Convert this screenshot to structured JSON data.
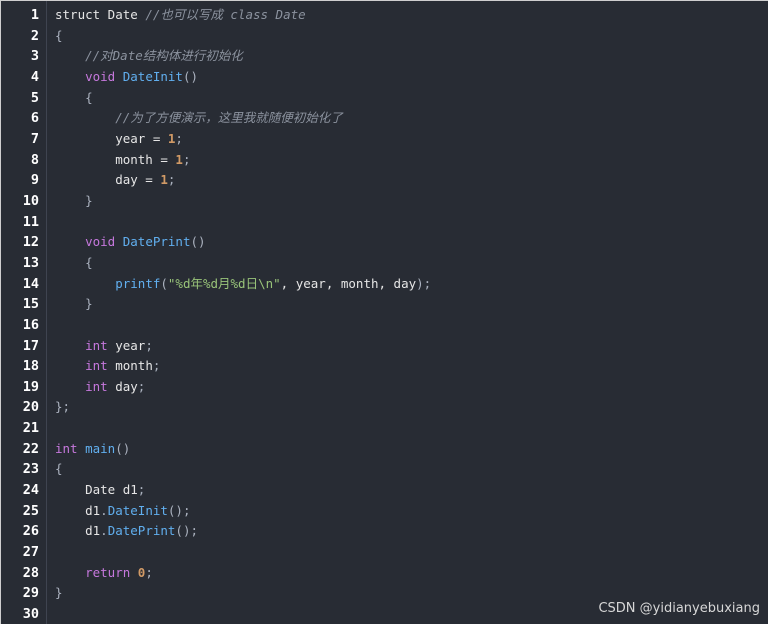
{
  "watermark": "CSDN @yidianyebuxiang",
  "colors": {
    "background": "#282c34",
    "line_number": "#ffffff",
    "keyword": "#c678dd",
    "function": "#61afef",
    "number": "#d19a66",
    "string": "#98c379",
    "comment": "#8b929e"
  },
  "lines": [
    {
      "num": "1",
      "tokens": [
        [
          "ident",
          "struct Date "
        ],
        [
          "cmt",
          "//也可以写成 class Date"
        ]
      ]
    },
    {
      "num": "2",
      "tokens": [
        [
          "punct",
          "{"
        ]
      ]
    },
    {
      "num": "3",
      "tokens": [
        [
          "punct",
          "    "
        ],
        [
          "cmt",
          "//对Date结构体进行初始化"
        ]
      ]
    },
    {
      "num": "4",
      "tokens": [
        [
          "punct",
          "    "
        ],
        [
          "kw",
          "void"
        ],
        [
          "ident",
          " "
        ],
        [
          "fn",
          "DateInit"
        ],
        [
          "punct",
          "()"
        ]
      ]
    },
    {
      "num": "5",
      "tokens": [
        [
          "punct",
          "    {"
        ]
      ]
    },
    {
      "num": "6",
      "tokens": [
        [
          "punct",
          "        "
        ],
        [
          "cmt",
          "//为了方便演示，这里我就随便初始化了"
        ]
      ]
    },
    {
      "num": "7",
      "tokens": [
        [
          "ident",
          "        year = "
        ],
        [
          "num",
          "1"
        ],
        [
          "punct",
          ";"
        ]
      ]
    },
    {
      "num": "8",
      "tokens": [
        [
          "ident",
          "        month = "
        ],
        [
          "num",
          "1"
        ],
        [
          "punct",
          ";"
        ]
      ]
    },
    {
      "num": "9",
      "tokens": [
        [
          "ident",
          "        day = "
        ],
        [
          "num",
          "1"
        ],
        [
          "punct",
          ";"
        ]
      ]
    },
    {
      "num": "10",
      "tokens": [
        [
          "punct",
          "    }"
        ]
      ]
    },
    {
      "num": "11",
      "tokens": []
    },
    {
      "num": "12",
      "tokens": [
        [
          "punct",
          "    "
        ],
        [
          "kw",
          "void"
        ],
        [
          "ident",
          " "
        ],
        [
          "fn",
          "DatePrint"
        ],
        [
          "punct",
          "()"
        ]
      ]
    },
    {
      "num": "13",
      "tokens": [
        [
          "punct",
          "    {"
        ]
      ]
    },
    {
      "num": "14",
      "tokens": [
        [
          "punct",
          "        "
        ],
        [
          "fn",
          "printf"
        ],
        [
          "punct",
          "("
        ],
        [
          "str",
          "\"%d年%d月%d日\\n\""
        ],
        [
          "ident",
          ", year, month, day"
        ],
        [
          "punct",
          ");"
        ]
      ]
    },
    {
      "num": "15",
      "tokens": [
        [
          "punct",
          "    }"
        ]
      ]
    },
    {
      "num": "16",
      "tokens": []
    },
    {
      "num": "17",
      "tokens": [
        [
          "punct",
          "    "
        ],
        [
          "kw",
          "int"
        ],
        [
          "ident",
          " year"
        ],
        [
          "punct",
          ";"
        ]
      ]
    },
    {
      "num": "18",
      "tokens": [
        [
          "punct",
          "    "
        ],
        [
          "kw",
          "int"
        ],
        [
          "ident",
          " month"
        ],
        [
          "punct",
          ";"
        ]
      ]
    },
    {
      "num": "19",
      "tokens": [
        [
          "punct",
          "    "
        ],
        [
          "kw",
          "int"
        ],
        [
          "ident",
          " day"
        ],
        [
          "punct",
          ";"
        ]
      ]
    },
    {
      "num": "20",
      "tokens": [
        [
          "punct",
          "};"
        ]
      ]
    },
    {
      "num": "21",
      "tokens": []
    },
    {
      "num": "22",
      "tokens": [
        [
          "kw",
          "int"
        ],
        [
          "ident",
          " "
        ],
        [
          "fn",
          "main"
        ],
        [
          "punct",
          "()"
        ]
      ]
    },
    {
      "num": "23",
      "tokens": [
        [
          "punct",
          "{"
        ]
      ]
    },
    {
      "num": "24",
      "tokens": [
        [
          "ident",
          "    Date d1"
        ],
        [
          "punct",
          ";"
        ]
      ]
    },
    {
      "num": "25",
      "tokens": [
        [
          "ident",
          "    d1"
        ],
        [
          "punct",
          "."
        ],
        [
          "fn",
          "DateInit"
        ],
        [
          "punct",
          "();"
        ]
      ]
    },
    {
      "num": "26",
      "tokens": [
        [
          "ident",
          "    d1"
        ],
        [
          "punct",
          "."
        ],
        [
          "fn",
          "DatePrint"
        ],
        [
          "punct",
          "();"
        ]
      ]
    },
    {
      "num": "27",
      "tokens": []
    },
    {
      "num": "28",
      "tokens": [
        [
          "punct",
          "    "
        ],
        [
          "kw",
          "return"
        ],
        [
          "ident",
          " "
        ],
        [
          "num",
          "0"
        ],
        [
          "punct",
          ";"
        ]
      ]
    },
    {
      "num": "29",
      "tokens": [
        [
          "punct",
          "}"
        ]
      ]
    },
    {
      "num": "30",
      "tokens": []
    }
  ]
}
